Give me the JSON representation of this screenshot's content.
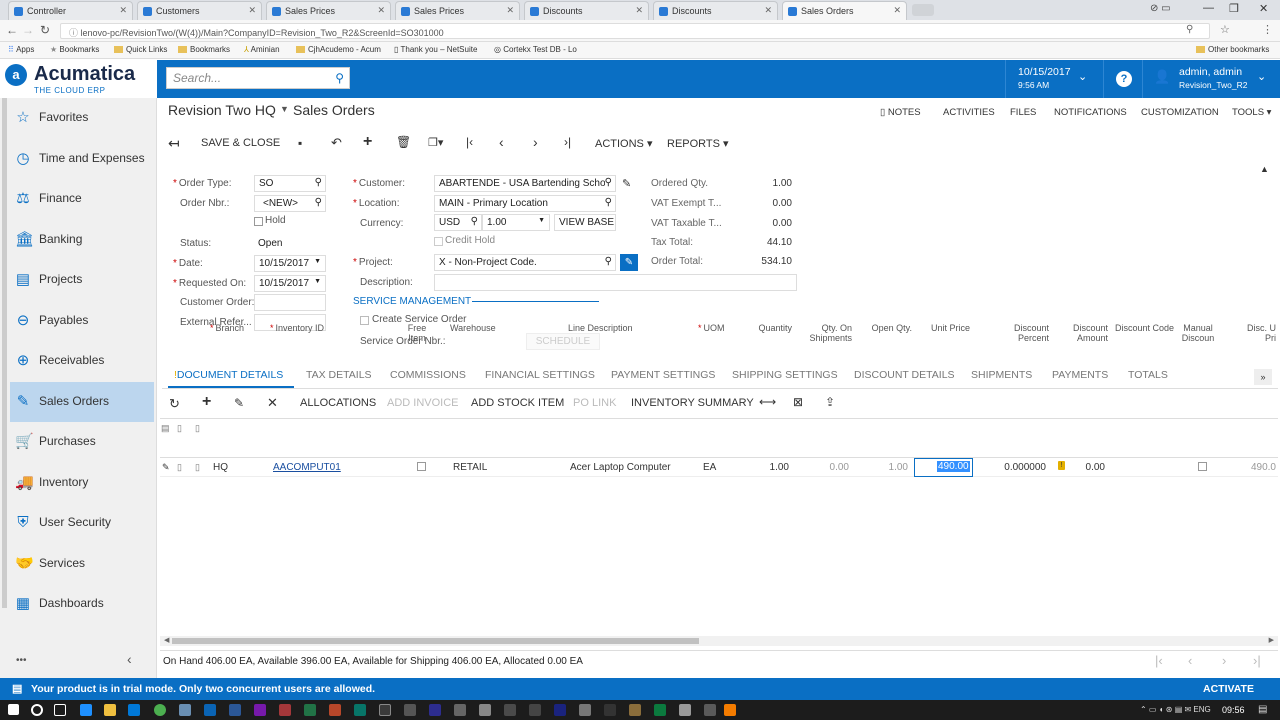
{
  "browser": {
    "tabs": [
      "Controller",
      "Customers",
      "Sales Prices",
      "Sales Prices",
      "Discounts",
      "Discounts",
      "Sales Orders"
    ],
    "url": "lenovo-pc/RevisionTwo/(W(4))/Main?CompanyID=Revision_Two_R2&ScreenId=SO301000",
    "bookmarks": [
      "Apps",
      "Bookmarks",
      "Quick Links",
      "Bookmarks",
      "Aminian",
      "CjhAcudemo - Acum",
      "Thank you – NetSuite",
      "Cortekx Test DB - Lo"
    ],
    "other_bookmarks": "Other bookmarks"
  },
  "header": {
    "logo_name": "Acumatica",
    "logo_tag": "THE CLOUD ERP",
    "search_placeholder": "Search...",
    "date": "10/15/2017",
    "time": "9:56 AM",
    "user": "admin, admin",
    "company": "Revision_Two_R2",
    "help": "?"
  },
  "sidebar": {
    "items": [
      {
        "label": "Favorites",
        "icon": "star-icon"
      },
      {
        "label": "Time and Expenses",
        "icon": "clock-icon"
      },
      {
        "label": "Finance",
        "icon": "scales-icon"
      },
      {
        "label": "Banking",
        "icon": "bank-icon"
      },
      {
        "label": "Projects",
        "icon": "projects-icon"
      },
      {
        "label": "Payables",
        "icon": "minus-circle-icon"
      },
      {
        "label": "Receivables",
        "icon": "plus-circle-icon"
      },
      {
        "label": "Sales Orders",
        "icon": "edit-icon"
      },
      {
        "label": "Purchases",
        "icon": "cart-icon"
      },
      {
        "label": "Inventory",
        "icon": "truck-icon"
      },
      {
        "label": "User Security",
        "icon": "shield-icon"
      },
      {
        "label": "Services",
        "icon": "handshake-icon"
      },
      {
        "label": "Dashboards",
        "icon": "dashboard-icon"
      }
    ],
    "more": "•••",
    "collapse": "‹"
  },
  "page": {
    "breadcrumb_company": "Revision Two HQ",
    "title": "Sales Orders",
    "top_links": [
      "NOTES",
      "ACTIVITIES",
      "FILES",
      "NOTIFICATIONS",
      "CUSTOMIZATION",
      "TOOLS"
    ],
    "toolbar": {
      "save_close": "SAVE & CLOSE",
      "actions": "ACTIONS",
      "reports": "REPORTS"
    }
  },
  "form": {
    "order_type_label": "Order Type:",
    "order_type": "SO",
    "order_nbr_label": "Order Nbr.:",
    "order_nbr": "<NEW>",
    "hold_label": "Hold",
    "status_label": "Status:",
    "status": "Open",
    "date_label": "Date:",
    "date": "10/15/2017",
    "requested_on_label": "Requested On:",
    "requested_on": "10/15/2017",
    "customer_order_label": "Customer Order:",
    "external_ref_label": "External Refer...",
    "customer_label": "Customer:",
    "customer": "ABARTENDE - USA Bartending Scho",
    "location_label": "Location:",
    "location": "MAIN - Primary Location",
    "currency_label": "Currency:",
    "currency": "USD",
    "rate": "1.00",
    "view_base": "VIEW BASE",
    "credit_hold_label": "Credit Hold",
    "project_label": "Project:",
    "project": "X - Non-Project Code.",
    "description_label": "Description:",
    "service_mgmt": "SERVICE MANAGEMENT",
    "create_service_order_label": "Create Service Order",
    "service_order_nbr_label": "Service Order Nbr.:",
    "schedule": "SCHEDULE",
    "ordered_qty_label": "Ordered Qty.",
    "ordered_qty": "1.00",
    "vat_exempt_label": "VAT Exempt T...",
    "vat_exempt": "0.00",
    "vat_taxable_label": "VAT Taxable T...",
    "vat_taxable": "0.00",
    "tax_total_label": "Tax Total:",
    "tax_total": "44.10",
    "order_total_label": "Order Total:",
    "order_total": "534.10"
  },
  "tabs": [
    "DOCUMENT DETAILS",
    "TAX DETAILS",
    "COMMISSIONS",
    "FINANCIAL SETTINGS",
    "PAYMENT SETTINGS",
    "SHIPPING SETTINGS",
    "DISCOUNT DETAILS",
    "SHIPMENTS",
    "PAYMENTS",
    "TOTALS"
  ],
  "grid_toolbar": {
    "allocations": "ALLOCATIONS",
    "add_invoice": "ADD INVOICE",
    "add_stock_item": "ADD STOCK ITEM",
    "po_link": "PO LINK",
    "inventory_summary": "INVENTORY SUMMARY"
  },
  "grid": {
    "headers": [
      "Branch",
      "Inventory ID",
      "Free Item",
      "Warehouse",
      "Line Description",
      "UOM",
      "Quantity",
      "Qty. On Shipments",
      "Open Qty.",
      "Unit Price",
      "Discount Percent",
      "Discount Amount",
      "Discount Code",
      "Manual Discoun",
      "Disc. U Pri"
    ],
    "row": {
      "branch": "HQ",
      "inventory_id": "AACOMPUT01",
      "warehouse": "RETAIL",
      "description": "Acer Laptop Computer",
      "uom": "EA",
      "quantity": "1.00",
      "qty_on_shipments": "0.00",
      "open_qty": "1.00",
      "unit_price": "490.00",
      "discount_percent": "0.000000",
      "discount_amount": "0.00",
      "disc_unit_price": "490.0"
    }
  },
  "status_line": "On Hand 406.00 EA, Available 396.00 EA, Available for Shipping 406.00 EA, Allocated 0.00 EA",
  "trial": {
    "message": "Your product is in trial mode. Only two concurrent users are allowed.",
    "activate": "ACTIVATE"
  },
  "taskbar": {
    "time": "09:56"
  },
  "colors": {
    "brand": "#0a6fc4",
    "selected_nav": "#bcd6ee"
  }
}
